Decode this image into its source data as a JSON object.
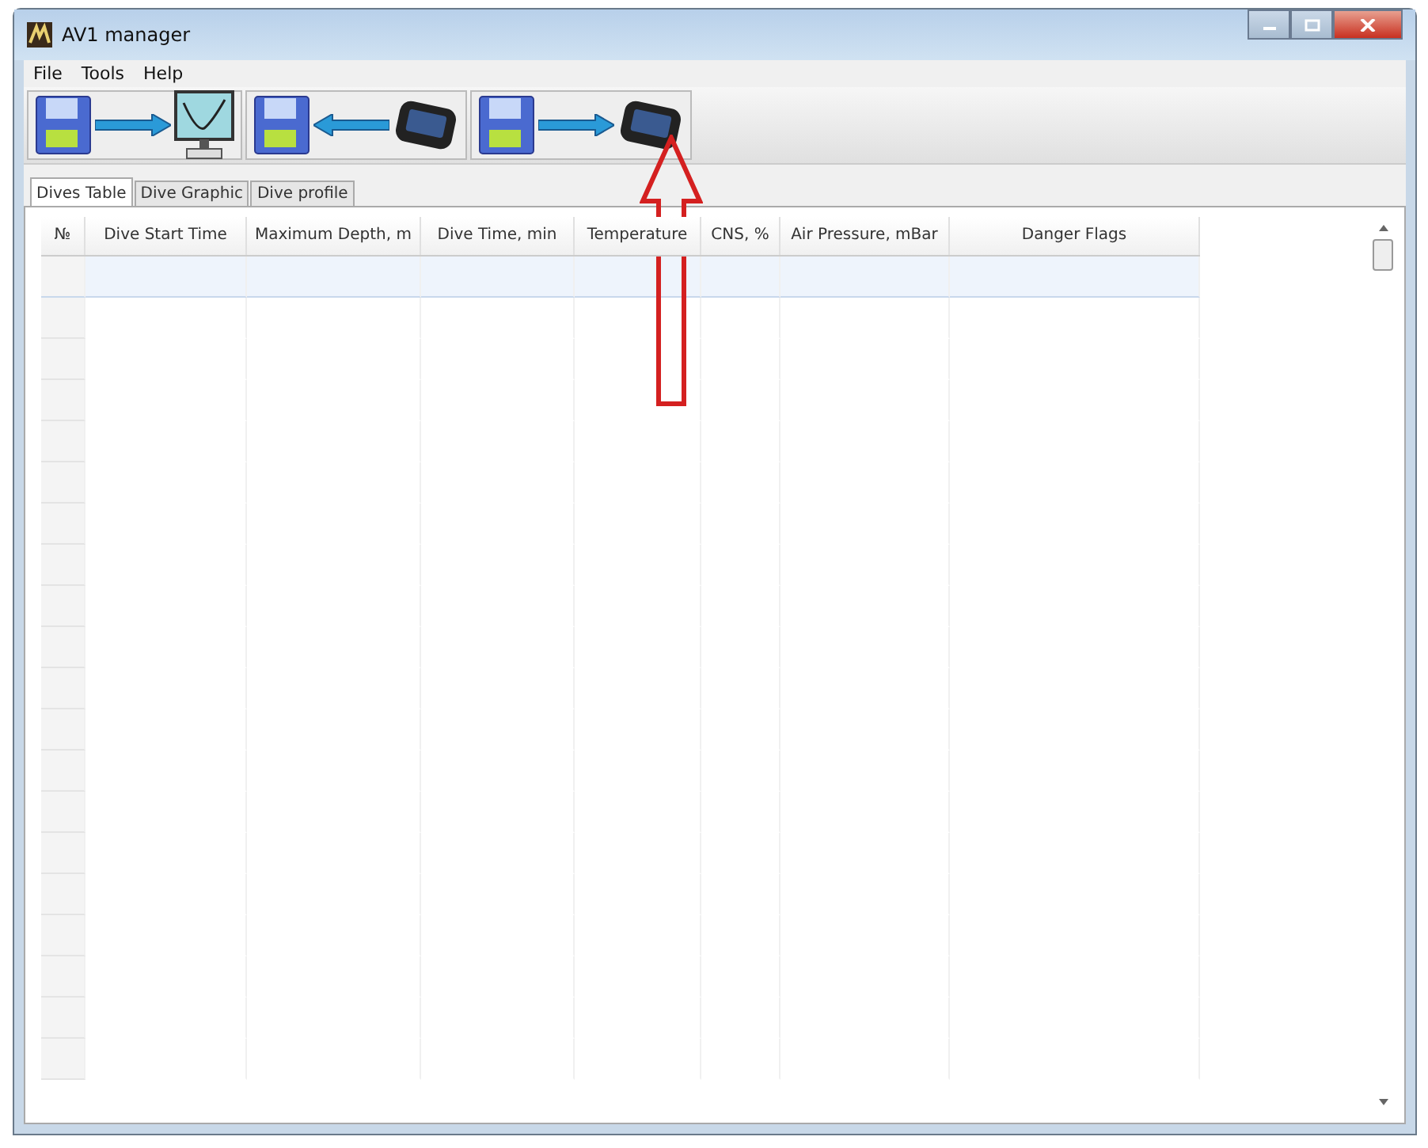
{
  "window": {
    "title": "AV1 manager"
  },
  "menu": [
    "File",
    "Tools",
    "Help"
  ],
  "toolbar": [
    {
      "kind": "graph"
    },
    {
      "kind": "download"
    },
    {
      "kind": "upload"
    }
  ],
  "tabs": [
    {
      "label": "Dives Table",
      "selected": true
    },
    {
      "label": "Dive Graphic",
      "selected": false
    },
    {
      "label": "Dive profile",
      "selected": false
    }
  ],
  "table": {
    "columns": [
      "№",
      "Dive Start Time",
      "Maximum Depth, m",
      "Dive Time, min",
      "Temperature",
      "CNS, %",
      "Air Pressure, mBar",
      "Danger Flags"
    ],
    "rows": [
      {
        "selected": true
      },
      {
        "selected": false
      },
      {
        "selected": false
      },
      {
        "selected": false
      },
      {
        "selected": false
      },
      {
        "selected": false
      },
      {
        "selected": false
      },
      {
        "selected": false
      },
      {
        "selected": false
      },
      {
        "selected": false
      },
      {
        "selected": false
      },
      {
        "selected": false
      },
      {
        "selected": false
      },
      {
        "selected": false
      },
      {
        "selected": false
      },
      {
        "selected": false
      },
      {
        "selected": false
      },
      {
        "selected": false
      },
      {
        "selected": false
      },
      {
        "selected": false
      }
    ]
  }
}
